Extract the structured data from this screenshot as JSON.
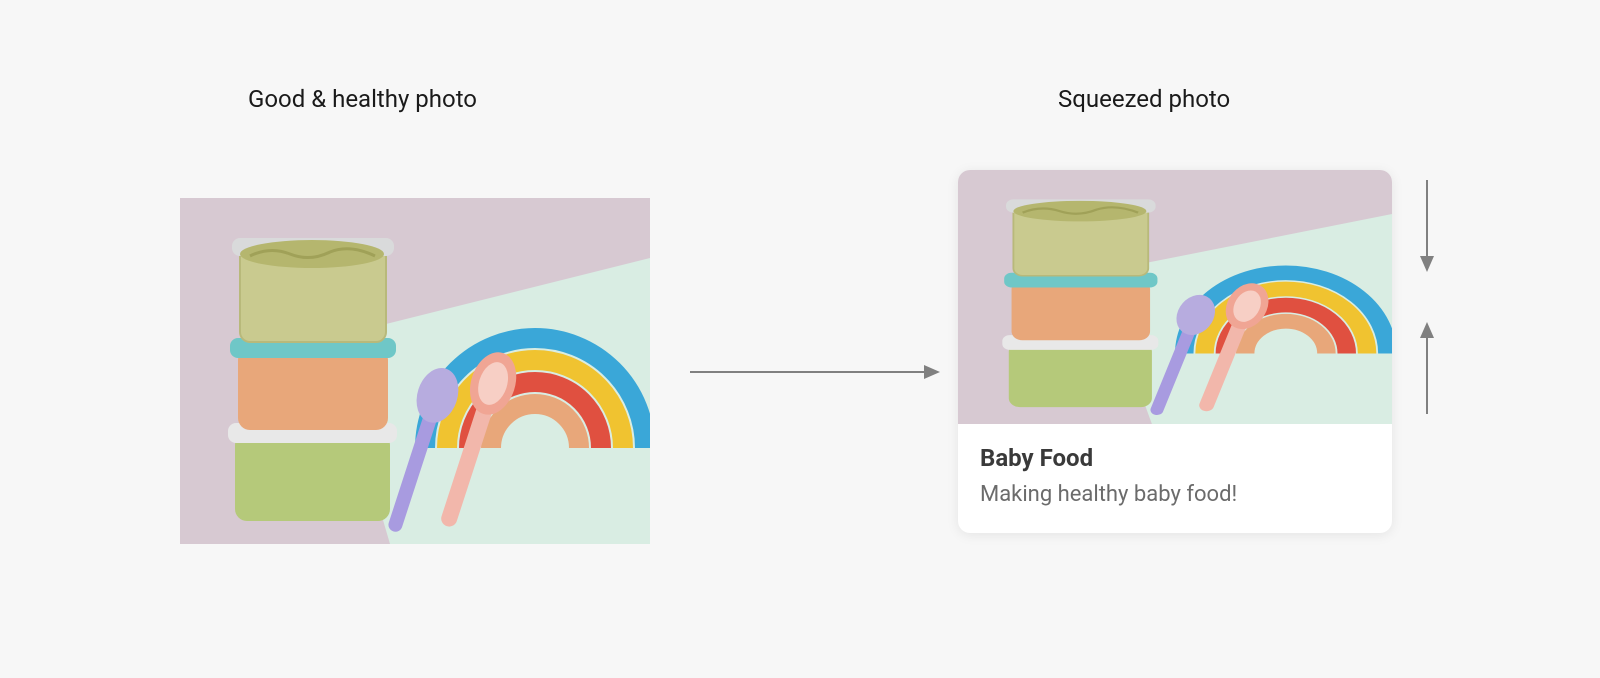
{
  "labels": {
    "left": "Good & healthy photo",
    "right": "Squeezed photo"
  },
  "card": {
    "title": "Baby Food",
    "subtitle": "Making healthy baby food!"
  },
  "colors": {
    "background": "#f7f7f7",
    "card_bg": "#ffffff",
    "text_primary": "#1a1a1a",
    "text_title": "#3a3a3a",
    "text_muted": "#6b6b6b",
    "arrow": "#808080"
  },
  "photo": {
    "description": "Stacked glass containers of baby food puree with baby spoons on a rainbow napkin"
  }
}
